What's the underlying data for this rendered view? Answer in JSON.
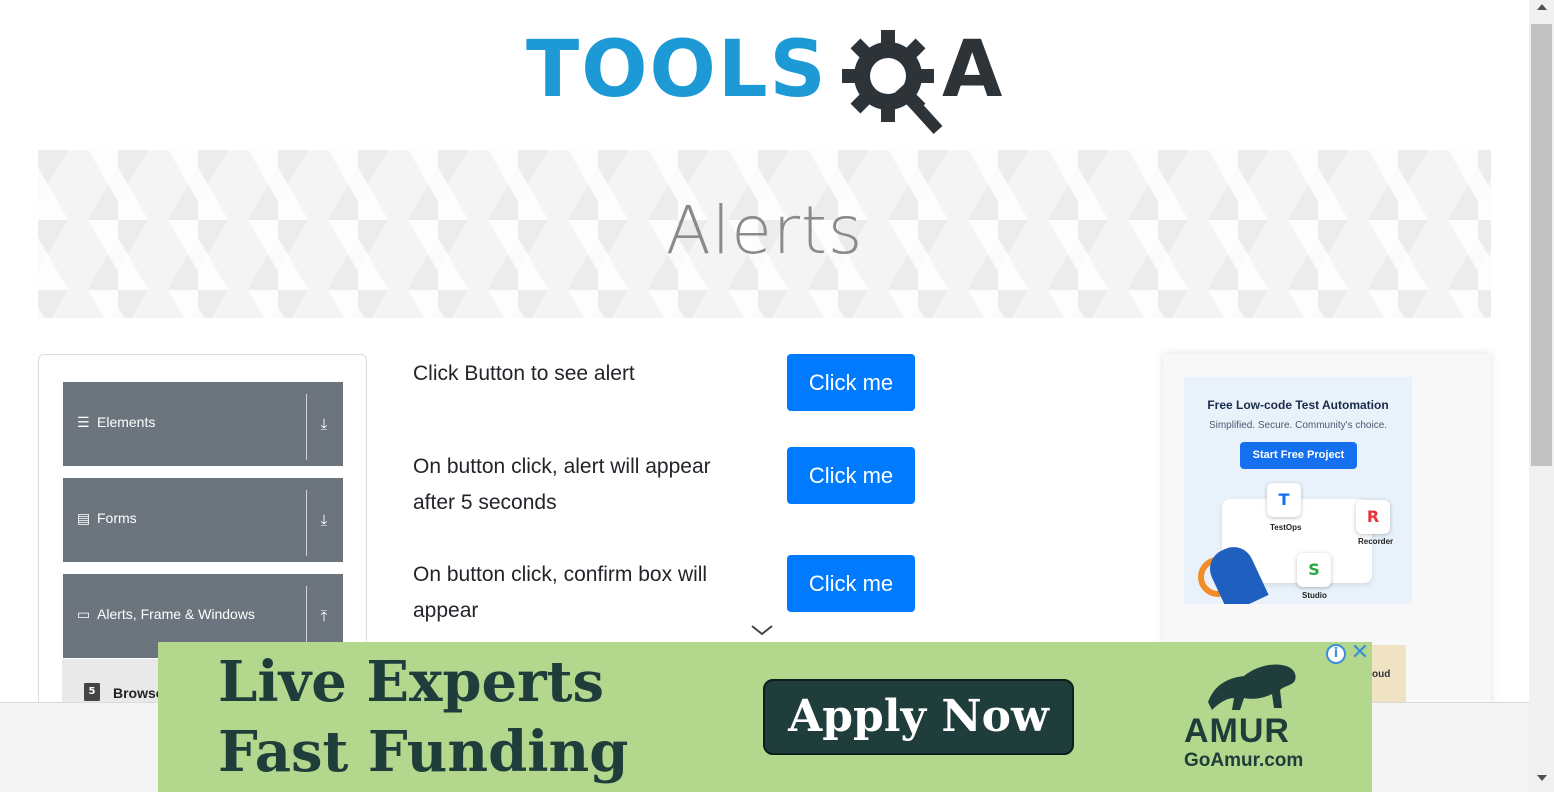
{
  "logo": {
    "text": "TOOLS",
    "suffix": "A",
    "colors": {
      "primary": "#1d9ad6",
      "dark": "#2e3338"
    }
  },
  "banner": {
    "title": "Alerts"
  },
  "sidebar": {
    "groups": [
      {
        "label": "Elements",
        "icon": "hamburger-icon",
        "arrow": "download-arrow-icon"
      },
      {
        "label": "Forms",
        "icon": "form-list-icon",
        "arrow": "download-arrow-icon"
      },
      {
        "label": "Alerts, Frame & Windows",
        "icon": "window-icon",
        "arrow": "upload-arrow-icon"
      }
    ],
    "sub_item": {
      "label": "Browser Windows",
      "icon": "html5-icon",
      "icon_text": "5"
    }
  },
  "main": {
    "rows": [
      {
        "text": "Click Button to see alert",
        "button": "Click me"
      },
      {
        "text": "On button click, alert will appear after 5 seconds",
        "button": "Click me"
      },
      {
        "text": "On button click, confirm box will appear",
        "button": "Click me"
      }
    ],
    "accent": "#007bff"
  },
  "side_ad": {
    "title": "Free Low-code Test Automation",
    "subtitle": "Simplified. Secure. Community's choice.",
    "cta": "Start Free Project",
    "apps": [
      "TestOps",
      "Recorder",
      "Studio"
    ],
    "app_letters": [
      "T",
      "R",
      "S"
    ],
    "bottom_text": "oud"
  },
  "bottom_ad": {
    "line1": "Live Experts",
    "line2": "Fast Funding",
    "cta": "Apply Now",
    "brand": "AMUR",
    "brand_url": "GoAmur.com",
    "info": "i",
    "close": "✕",
    "background": "#b3d78d"
  }
}
